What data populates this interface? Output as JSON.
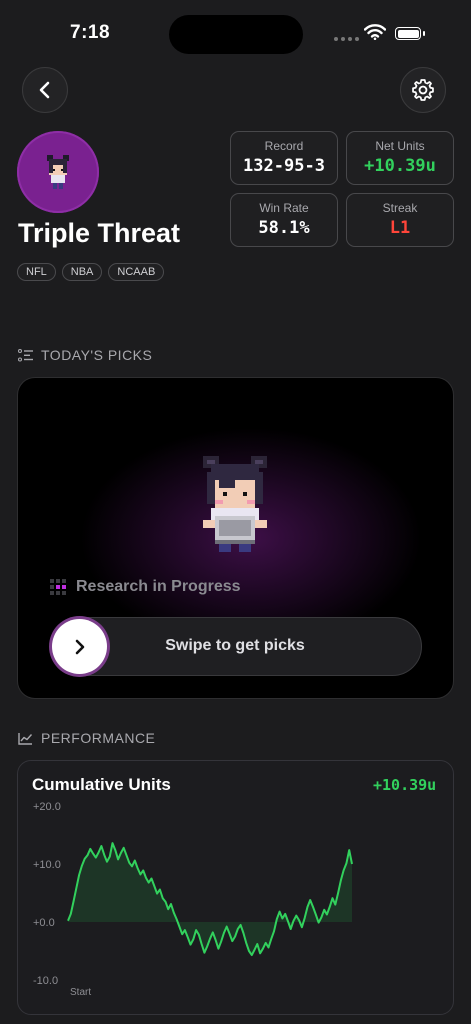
{
  "status_bar": {
    "time": "7:18"
  },
  "profile": {
    "name": "Triple Threat",
    "leagues": [
      "NFL",
      "NBA",
      "NCAAB"
    ]
  },
  "stats": {
    "record": {
      "label": "Record",
      "value": "132-95-3"
    },
    "net_units": {
      "label": "Net Units",
      "value": "+10.39u",
      "color": "#32d15d"
    },
    "win_rate": {
      "label": "Win Rate",
      "value": "58.1%"
    },
    "streak": {
      "label": "Streak",
      "value": "L1",
      "color": "#ff453a"
    }
  },
  "todays_picks": {
    "heading": "TODAY'S PICKS",
    "research_text": "Research in Progress",
    "swipe_label": "Swipe to get picks"
  },
  "performance": {
    "heading": "PERFORMANCE",
    "card_title": "Cumulative Units",
    "total": "+10.39u"
  },
  "colors": {
    "accent_purple": "#7a2190",
    "positive": "#32d15d",
    "negative": "#ff453a"
  },
  "icons": {
    "back": "chevron-left-icon",
    "settings": "gear-icon",
    "picks": "list-icon",
    "performance": "trend-chart-icon",
    "swipe": "chevron-right-icon"
  },
  "chart_data": {
    "type": "line",
    "title": "Cumulative Units",
    "xlabel": "Start",
    "ylabel": "",
    "yticks": [
      "+20.0",
      "+10.0",
      "+0.0",
      "-10.0"
    ],
    "ylim": [
      -10,
      20
    ],
    "grid": false,
    "series": [
      {
        "values": [
          0.2,
          1.4,
          3.6,
          5.9,
          8.1,
          9.7,
          10.9,
          11.5,
          12.6,
          11.8,
          11.1,
          12.0,
          13.1,
          11.6,
          10.4,
          11.3,
          13.6,
          12.4,
          10.8,
          11.9,
          12.8,
          11.5,
          10.2,
          9.6,
          10.6,
          9.3,
          8.2,
          8.9,
          7.6,
          6.8,
          7.5,
          6.2,
          4.9,
          5.6,
          4.1,
          3.5,
          2.2,
          3.1,
          1.6,
          0.5,
          -0.8,
          -2.1,
          -1.4,
          -2.6,
          -3.9,
          -3.0,
          -1.4,
          -2.2,
          -3.8,
          -5.3,
          -4.2,
          -2.9,
          -1.8,
          -3.1,
          -4.6,
          -3.4,
          -1.9,
          -0.8,
          -2.0,
          -3.3,
          -2.5,
          -1.2,
          -0.5,
          -1.9,
          -3.6,
          -5.0,
          -5.7,
          -4.8,
          -3.8,
          -5.4,
          -4.6,
          -3.6,
          -4.4,
          -2.9,
          -1.6,
          0.5,
          1.8,
          0.6,
          1.4,
          0.1,
          -1.2,
          0.2,
          1.1,
          0.3,
          -0.9,
          0.7,
          2.6,
          3.8,
          2.6,
          1.3,
          -0.1,
          0.8,
          2.1,
          1.3,
          2.6,
          4.1,
          3.0,
          5.0,
          7.2,
          8.9,
          10.1,
          12.4,
          10.0
        ]
      }
    ]
  }
}
